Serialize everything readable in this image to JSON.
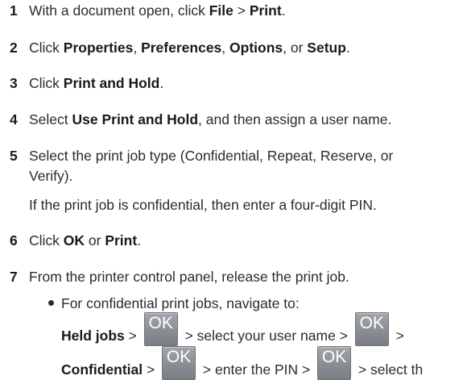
{
  "steps": [
    {
      "num": "1",
      "parts": [
        "With a document open, click ",
        "File",
        " > ",
        "Print",
        "."
      ]
    },
    {
      "num": "2",
      "parts": [
        "Click ",
        "Properties",
        ", ",
        "Preferences",
        ", ",
        "Options",
        ", or ",
        "Setup",
        "."
      ]
    },
    {
      "num": "3",
      "parts": [
        "Click ",
        "Print and Hold",
        "."
      ]
    },
    {
      "num": "4",
      "parts": [
        "Select ",
        "Use Print and Hold",
        ", and then assign a user name."
      ]
    },
    {
      "num": "5",
      "line1": "Select the print job type (Confidential, Repeat, Reserve, or",
      "line2": "Verify)."
    },
    {
      "num": "6",
      "parts": [
        "Click ",
        "OK",
        " or ",
        "Print",
        "."
      ]
    },
    {
      "num": "7",
      "text": "From the printer control panel, release the print job."
    }
  ],
  "confidential_note": "If the print job is confidential, then enter a four-digit PIN.",
  "bullet": "For confidential print jobs, navigate to:",
  "nav1": {
    "held_jobs": "Held jobs",
    "sep1": " > ",
    "ok": "OK",
    "mid": " > select your user name > ",
    "ok2": "OK",
    "end": " >"
  },
  "nav2": {
    "confidential": "Confidential",
    "sep1": " > ",
    "ok": "OK",
    "mid": " > enter the PIN > ",
    "ok2": "OK",
    "end": " > select th"
  }
}
